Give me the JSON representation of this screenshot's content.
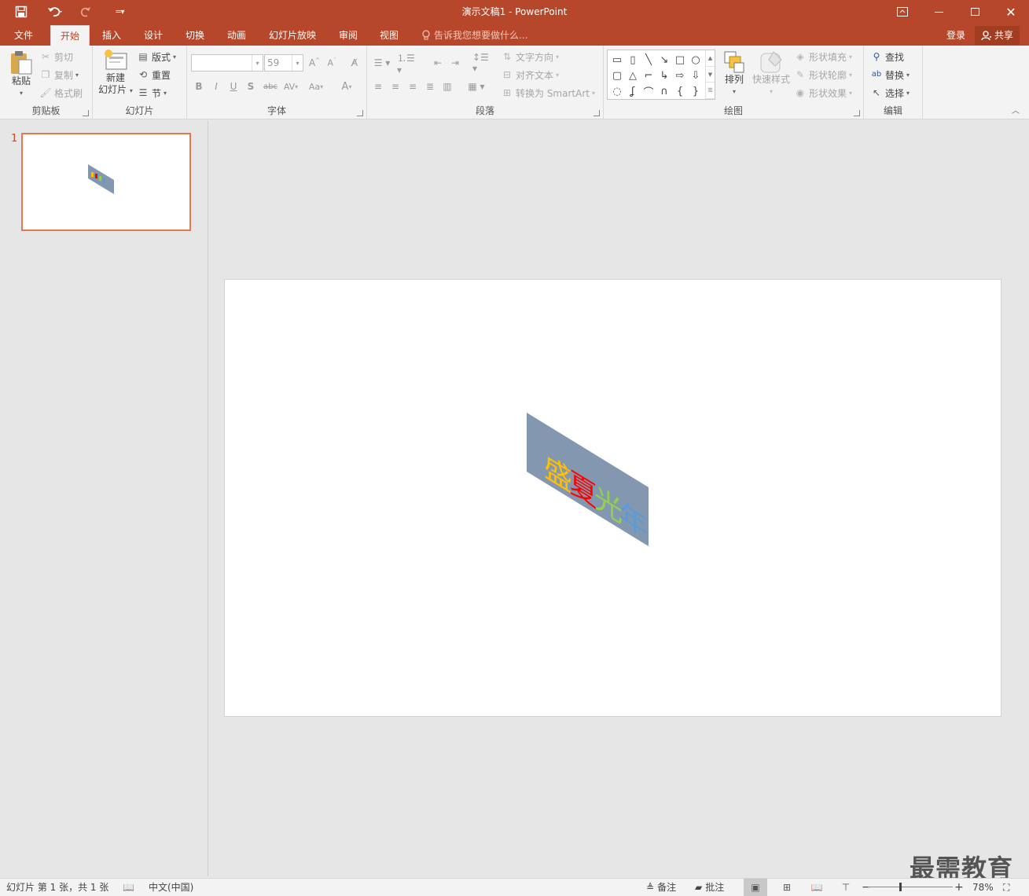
{
  "app": {
    "title": "演示文稿1 - PowerPoint"
  },
  "quick_access": {
    "save_icon": "save-icon",
    "undo_icon": "undo-icon",
    "redo_icon": "redo-icon",
    "customize_icon": "customize-qat-icon"
  },
  "tabs": [
    "文件",
    "开始",
    "插入",
    "设计",
    "切换",
    "动画",
    "幻灯片放映",
    "审阅",
    "视图"
  ],
  "active_tab": "开始",
  "tell_me": "告诉我您想要做什么...",
  "account": {
    "login": "登录",
    "share": "共享"
  },
  "ribbon": {
    "clipboard": {
      "label": "剪贴板",
      "paste": "粘贴",
      "cut": "剪切",
      "copy": "复制",
      "format_painter": "格式刷"
    },
    "slides": {
      "label": "幻灯片",
      "new_slide_line1": "新建",
      "new_slide_line2": "幻灯片",
      "layout": "版式",
      "reset": "重置",
      "section": "节"
    },
    "font": {
      "label": "字体",
      "font_name": "",
      "font_size": "59",
      "bold": "B",
      "italic": "I",
      "underline": "U",
      "shadow": "S",
      "strike": "abc",
      "spacing": "AV",
      "case": "Aa",
      "color": "A"
    },
    "paragraph": {
      "label": "段落",
      "text_direction": "文字方向",
      "align_text": "对齐文本",
      "convert_smartart": "转换为 SmartArt"
    },
    "drawing": {
      "label": "绘图",
      "arrange": "排列",
      "quick_styles": "快速样式",
      "shape_fill": "形状填充",
      "shape_outline": "形状轮廓",
      "shape_effects": "形状效果"
    },
    "editing": {
      "label": "编辑",
      "find": "查找",
      "replace": "替换",
      "select": "选择"
    }
  },
  "slides_pane": {
    "slide_number": "1"
  },
  "slide": {
    "wordart": {
      "chars": [
        "盛",
        "夏",
        "光",
        "年"
      ],
      "colors": [
        "#ffc000",
        "#ff0000",
        "#92d050",
        "#5b9bd5"
      ],
      "background": "#8497b0"
    }
  },
  "watermark": "最需教育",
  "status": {
    "slide_info": "幻灯片 第 1 张，共 1 张",
    "language": "中文(中国)",
    "notes": "备注",
    "comments": "批注",
    "zoom": "78%",
    "zoom_level": 0.78
  }
}
